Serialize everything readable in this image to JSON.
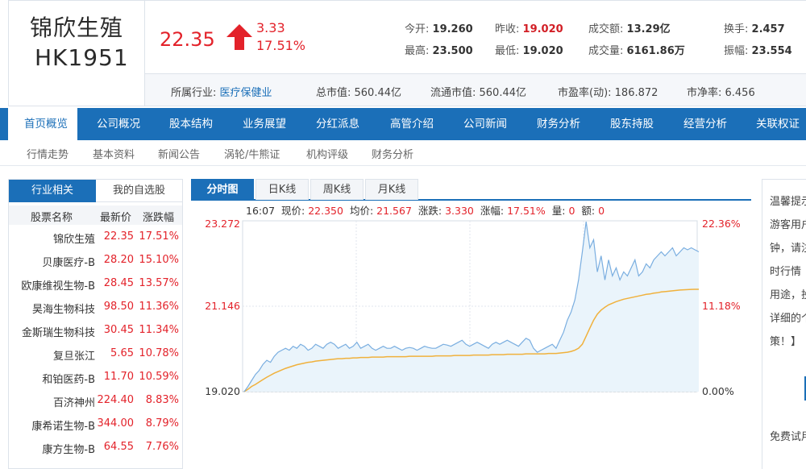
{
  "stock": {
    "name": "锦欣生殖",
    "code": "HK1951"
  },
  "quote": {
    "price": "22.35",
    "change": "3.33",
    "change_pct": "17.51%",
    "open_label": "今开:",
    "open": "19.260",
    "prev_close_label": "昨收:",
    "prev_close": "19.020",
    "amount_label": "成交额:",
    "amount": "13.29亿",
    "turnover_label": "换手:",
    "turnover": "2.457",
    "high_label": "最高:",
    "high": "23.500",
    "low_label": "最低:",
    "low": "19.020",
    "volume_label": "成交量:",
    "volume": "6161.86万",
    "amplitude_label": "振幅:",
    "amplitude": "23.554"
  },
  "info": {
    "industry_label": "所属行业:",
    "industry": "医疗保健业",
    "total_mv": "总市值: 560.44亿",
    "float_mv": "流通市值: 560.44亿",
    "pe": "市盈率(动): 186.872",
    "pb": "市净率: 6.456"
  },
  "nav": [
    "首页概览",
    "公司概况",
    "股本结构",
    "业务展望",
    "分红派息",
    "高管介绍",
    "公司新闻",
    "财务分析",
    "股东持股",
    "经营分析",
    "关联权证"
  ],
  "subnav": [
    "行情走势",
    "基本资料",
    "新闻公告",
    "涡轮/牛熊证",
    "机构评级",
    "财务分析"
  ],
  "left_panel": {
    "tabs": [
      "行业相关",
      "我的自选股"
    ],
    "headers": {
      "name": "股票名称",
      "price": "最新价",
      "pct": "涨跌幅"
    },
    "rows": [
      {
        "name": "锦欣生殖",
        "price": "22.35",
        "pct": "17.51%"
      },
      {
        "name": "贝康医疗-B",
        "price": "28.20",
        "pct": "15.10%"
      },
      {
        "name": "欧康维视生物-B",
        "price": "28.45",
        "pct": "13.57%"
      },
      {
        "name": "昊海生物科技",
        "price": "98.50",
        "pct": "11.36%"
      },
      {
        "name": "金斯瑞生物科技",
        "price": "30.45",
        "pct": "11.34%"
      },
      {
        "name": "复旦张江",
        "price": "5.65",
        "pct": "10.78%"
      },
      {
        "name": "和铂医药-B",
        "price": "11.70",
        "pct": "10.59%"
      },
      {
        "name": "百济神州",
        "price": "224.40",
        "pct": "8.83%"
      },
      {
        "name": "康希诺生物-B",
        "price": "344.00",
        "pct": "8.79%"
      },
      {
        "name": "康方生物-B",
        "price": "64.55",
        "pct": "7.76%"
      }
    ]
  },
  "chart_tabs": [
    "分时图",
    "日K线",
    "周K线",
    "月K线"
  ],
  "chart_info": {
    "time": "16:07",
    "price_label": "现价:",
    "price": "22.350",
    "avg_label": "均价:",
    "avg": "21.567",
    "chg_label": "涨跌:",
    "chg": "3.330",
    "pct_label": "涨幅:",
    "pct": "17.51%",
    "vol_label": "量:",
    "vol": "0",
    "amt_label": "额:",
    "amt": "0"
  },
  "chart_data": {
    "type": "line",
    "ylim": [
      19.02,
      23.272
    ],
    "y_ticks_left": [
      "23.272",
      "21.146",
      "19.020"
    ],
    "y_ticks_right": [
      "22.36%",
      "11.18%",
      "0.00%"
    ],
    "colors": {
      "price": "#7aaee0",
      "avg": "#f0b13c",
      "fill": "#eaf4fb",
      "up": "#e3222a"
    },
    "series": [
      {
        "values": [
          19.02,
          19.15,
          19.3,
          19.45,
          19.55,
          19.7,
          19.8,
          19.75,
          19.9,
          20.0,
          20.05,
          20.1,
          20.05,
          20.15,
          20.1,
          20.2,
          20.15,
          20.05,
          20.1,
          20.2,
          20.15,
          20.1,
          20.2,
          20.25,
          20.2,
          20.1,
          20.15,
          20.2,
          20.1,
          20.15,
          20.25,
          20.1,
          20.15,
          20.2,
          20.1,
          20.05,
          20.1,
          20.15,
          20.1,
          20.1,
          20.15,
          20.1,
          20.05,
          20.1,
          20.12,
          20.1,
          20.05,
          20.1,
          20.15,
          20.12,
          20.1,
          20.1,
          20.15,
          20.2,
          20.18,
          20.15,
          20.2,
          20.25,
          20.3,
          20.2,
          20.15,
          20.2,
          20.25,
          20.2,
          20.15,
          20.1,
          20.2,
          20.25,
          20.2,
          20.25,
          20.3,
          20.25,
          20.2,
          20.15,
          20.25,
          20.35,
          20.3,
          20.1,
          20.0,
          20.05,
          20.1,
          20.15,
          20.2,
          20.1,
          20.3,
          20.5,
          20.8,
          21.0,
          21.3,
          21.8,
          22.5,
          23.25,
          22.6,
          22.8,
          22.0,
          22.4,
          21.8,
          22.3,
          21.9,
          22.1,
          21.8,
          22.0,
          21.9,
          22.1,
          22.3,
          21.9,
          22.0,
          22.2,
          22.1,
          22.3,
          22.4,
          22.5,
          22.4,
          22.5,
          22.6,
          22.4,
          22.5,
          22.6,
          22.55,
          22.6,
          22.55,
          22.5
        ]
      },
      {
        "values": [
          19.02,
          19.08,
          19.15,
          19.2,
          19.26,
          19.32,
          19.38,
          19.43,
          19.48,
          19.52,
          19.56,
          19.6,
          19.63,
          19.66,
          19.69,
          19.71,
          19.73,
          19.75,
          19.76,
          19.78,
          19.79,
          19.8,
          19.81,
          19.82,
          19.83,
          19.84,
          19.84,
          19.85,
          19.85,
          19.86,
          19.86,
          19.87,
          19.87,
          19.87,
          19.88,
          19.88,
          19.88,
          19.88,
          19.89,
          19.89,
          19.89,
          19.89,
          19.89,
          19.89,
          19.9,
          19.9,
          19.9,
          19.9,
          19.9,
          19.9,
          19.9,
          19.91,
          19.91,
          19.91,
          19.91,
          19.91,
          19.92,
          19.92,
          19.92,
          19.92,
          19.92,
          19.93,
          19.93,
          19.93,
          19.93,
          19.93,
          19.94,
          19.94,
          19.94,
          19.94,
          19.95,
          19.95,
          19.95,
          19.95,
          19.95,
          19.96,
          19.96,
          19.96,
          19.96,
          19.96,
          19.96,
          19.97,
          19.97,
          19.97,
          19.98,
          19.99,
          20.0,
          20.02,
          20.05,
          20.1,
          20.2,
          20.4,
          20.6,
          20.8,
          20.95,
          21.05,
          21.12,
          21.18,
          21.22,
          21.26,
          21.29,
          21.32,
          21.34,
          21.36,
          21.38,
          21.4,
          21.42,
          21.44,
          21.45,
          21.47,
          21.48,
          21.5,
          21.51,
          21.52,
          21.53,
          21.54,
          21.55,
          21.555,
          21.56,
          21.565,
          21.567,
          21.567
        ]
      }
    ]
  },
  "right_panel": {
    "lines": [
      "温馨提示",
      "游客用户",
      "钟，请注",
      "时行情",
      "用途，投",
      "详细的个",
      "策！】",
      "免费试用"
    ]
  }
}
